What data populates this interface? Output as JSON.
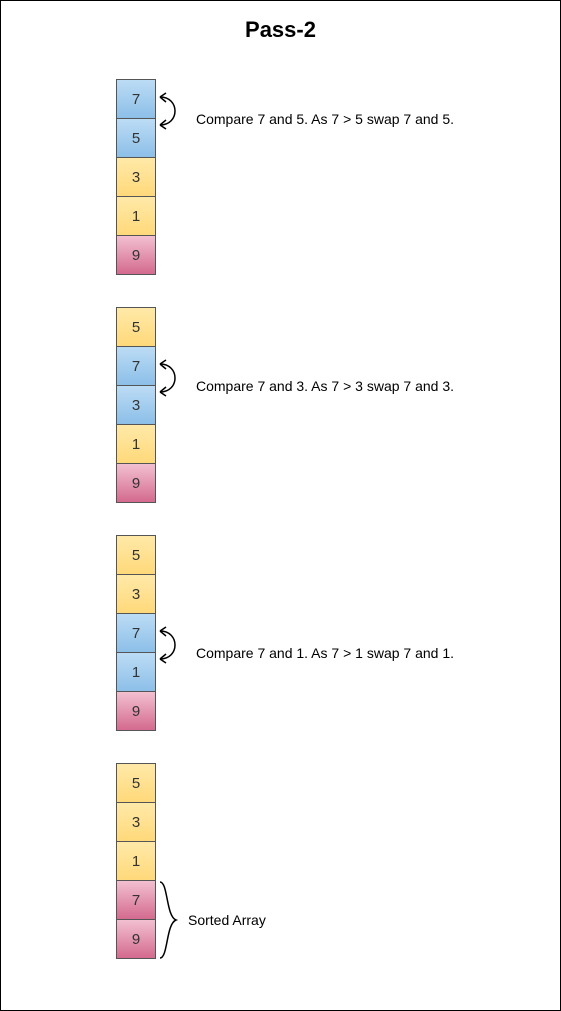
{
  "title": "Pass-2",
  "steps": [
    {
      "cells": [
        {
          "value": "7",
          "color": "blue"
        },
        {
          "value": "5",
          "color": "blue"
        },
        {
          "value": "3",
          "color": "yellow"
        },
        {
          "value": "1",
          "color": "yellow"
        },
        {
          "value": "9",
          "color": "red"
        }
      ],
      "swapIndices": [
        0,
        1
      ],
      "annotation": "Compare 7 and 5. As 7 > 5 swap 7 and 5."
    },
    {
      "cells": [
        {
          "value": "5",
          "color": "yellow"
        },
        {
          "value": "7",
          "color": "blue"
        },
        {
          "value": "3",
          "color": "blue"
        },
        {
          "value": "1",
          "color": "yellow"
        },
        {
          "value": "9",
          "color": "red"
        }
      ],
      "swapIndices": [
        1,
        2
      ],
      "annotation": "Compare 7 and 3. As 7 > 3 swap 7 and 3."
    },
    {
      "cells": [
        {
          "value": "5",
          "color": "yellow"
        },
        {
          "value": "3",
          "color": "yellow"
        },
        {
          "value": "7",
          "color": "blue"
        },
        {
          "value": "1",
          "color": "blue"
        },
        {
          "value": "9",
          "color": "red"
        }
      ],
      "swapIndices": [
        2,
        3
      ],
      "annotation": "Compare 7 and 1. As 7 > 1 swap 7 and 1."
    },
    {
      "cells": [
        {
          "value": "5",
          "color": "yellow"
        },
        {
          "value": "3",
          "color": "yellow"
        },
        {
          "value": "1",
          "color": "yellow"
        },
        {
          "value": "7",
          "color": "red"
        },
        {
          "value": "9",
          "color": "red"
        }
      ],
      "braceIndices": [
        3,
        4
      ],
      "braceLabel": "Sorted Array"
    }
  ],
  "chart_data": {
    "type": "table",
    "title": "Bubble Sort Pass-2",
    "pass": 2,
    "initial_array": [
      7,
      5,
      3,
      1,
      9
    ],
    "comparisons": [
      {
        "compare": [
          7,
          5
        ],
        "swap": true,
        "result": [
          5,
          7,
          3,
          1,
          9
        ]
      },
      {
        "compare": [
          7,
          3
        ],
        "swap": true,
        "result": [
          5,
          3,
          7,
          1,
          9
        ]
      },
      {
        "compare": [
          7,
          1
        ],
        "swap": true,
        "result": [
          5,
          3,
          1,
          7,
          9
        ]
      }
    ],
    "after_pass": [
      5,
      3,
      1,
      7,
      9
    ],
    "sorted_suffix": [
      7,
      9
    ]
  }
}
